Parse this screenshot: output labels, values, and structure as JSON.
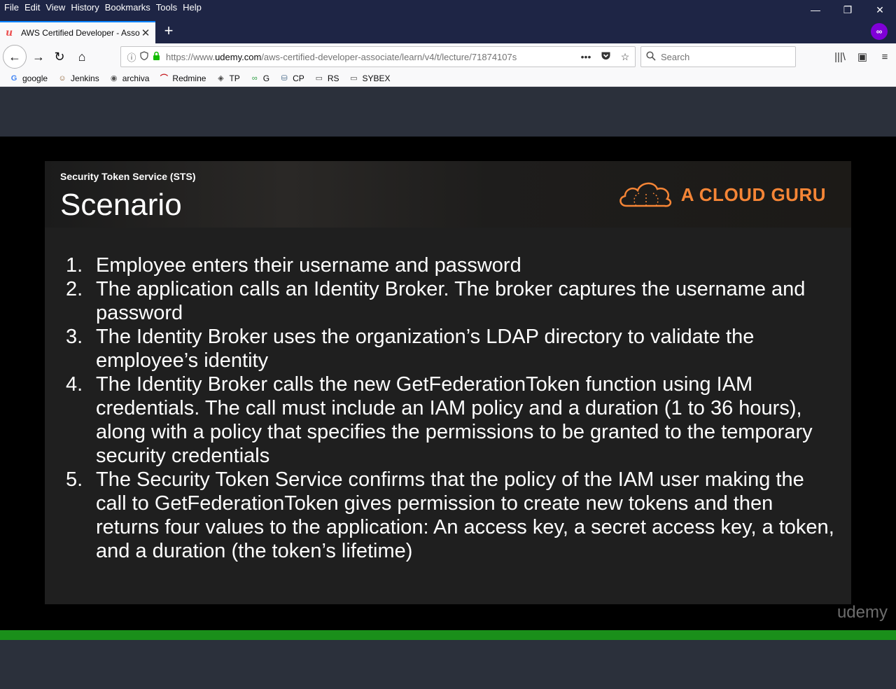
{
  "menu": {
    "items": [
      "File",
      "Edit",
      "View",
      "History",
      "Bookmarks",
      "Tools",
      "Help"
    ]
  },
  "window_controls": {
    "minimize": "—",
    "restore": "❐",
    "close": "✕"
  },
  "tab": {
    "favicon": "u",
    "title": "AWS Certified Developer - Asso",
    "close": "✕"
  },
  "new_tab": "+",
  "private_icon": "∞",
  "nav": {
    "back": "←",
    "forward": "→",
    "reload": "↻",
    "home": "⌂"
  },
  "urlbar": {
    "info_icon": "ⓘ",
    "url_prefix": "https://www.",
    "url_domain": "udemy.com",
    "url_path": "/aws-certified-developer-associate/learn/v4/t/lecture/71874107s",
    "more": "•••",
    "pocket": "⛉",
    "star": "☆"
  },
  "search": {
    "icon": "⌕",
    "placeholder": "Search"
  },
  "toolbar_right": {
    "library": "|||\\",
    "sidebar": "▣",
    "menu": "≡"
  },
  "bookmarks": [
    {
      "icon": "G",
      "label": "google"
    },
    {
      "icon": "☺",
      "label": "Jenkins"
    },
    {
      "icon": "◉",
      "label": "archiva"
    },
    {
      "icon": "⌒",
      "label": "Redmine"
    },
    {
      "icon": "◈",
      "label": "TP"
    },
    {
      "icon": "∞",
      "label": "G"
    },
    {
      "icon": "⛁",
      "label": "CP"
    },
    {
      "icon": "▭",
      "label": "RS"
    },
    {
      "icon": "▭",
      "label": "SYBEX"
    }
  ],
  "slide": {
    "subtitle": "Security Token Service (STS)",
    "title": "Scenario",
    "brand": "A CLOUD GURU",
    "items": [
      {
        "num": "1.",
        "text": "Employee enters their username and password"
      },
      {
        "num": "2.",
        "text": "The application calls an Identity Broker. The broker captures the username and password"
      },
      {
        "num": "3.",
        "text": "The Identity Broker uses the organization’s LDAP directory to validate the employee’s identity"
      },
      {
        "num": "4.",
        "text": "The Identity Broker calls the new GetFederationToken function using IAM credentials. The call must include an IAM policy and a duration (1 to 36 hours), along with a policy that  specifies the permissions to be granted to the temporary security credentials"
      },
      {
        "num": "5.",
        "text": "The Security Token Service confirms that the policy of the IAM user making the call to GetFederationToken gives permission to create new tokens and then returns four values to the application: An access key, a secret access key, a token, and a duration (the token’s lifetime)"
      }
    ]
  },
  "watermark": "udemy",
  "colors": {
    "accent": "#0a84ff",
    "brand_orange": "#f58536",
    "progress": "#1a8f1a",
    "private": "#8000d7"
  }
}
